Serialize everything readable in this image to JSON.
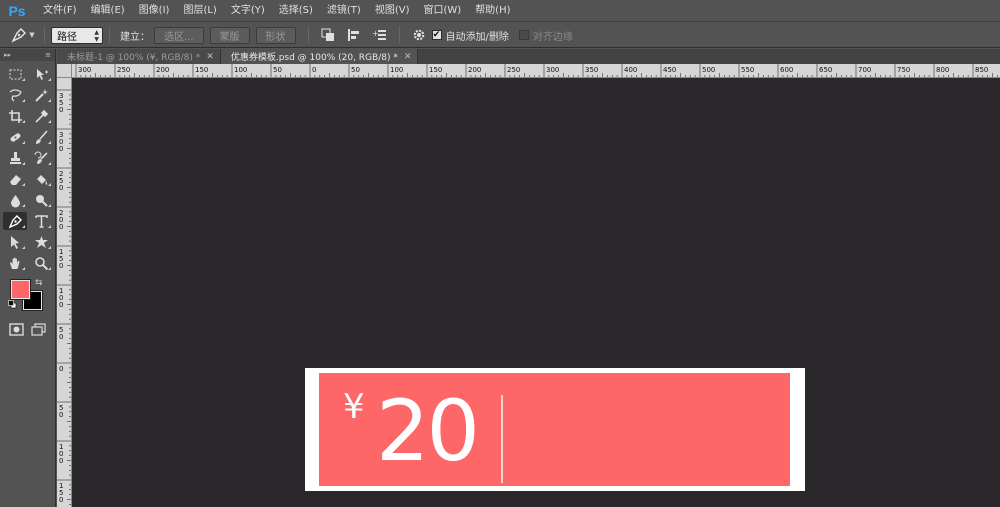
{
  "app": {
    "logo": "Ps"
  },
  "menu": [
    "文件(F)",
    "编辑(E)",
    "图像(I)",
    "图层(L)",
    "文字(Y)",
    "选择(S)",
    "滤镜(T)",
    "视图(V)",
    "窗口(W)",
    "帮助(H)"
  ],
  "options": {
    "mode": "路径",
    "make_label": "建立：",
    "selection_btn": "选区...",
    "mask_btn": "蒙版",
    "shape_btn": "形状",
    "auto_add_delete_label": "自动添加/删除",
    "auto_add_delete_checked": true,
    "align_edges_label": "对齐边缘",
    "align_edges_checked": false
  },
  "tabs": [
    {
      "label": "未标题-1 @ 100% (¥, RGB/8) *",
      "active": false
    },
    {
      "label": "优惠券模板.psd @ 100% (20, RGB/8) *",
      "active": true
    }
  ],
  "ruler": {
    "h_labels": [
      "300",
      "250",
      "200",
      "150",
      "100",
      "50",
      "0",
      "50",
      "100",
      "150",
      "200",
      "250",
      "300",
      "350",
      "400",
      "450",
      "500",
      "550",
      "600",
      "650",
      "700",
      "750",
      "800",
      "850"
    ],
    "v_labels": [
      "3 5 0",
      "3 0 0",
      "2 5 0",
      "2 0 0",
      "1 5 0",
      "1 0 0",
      "5 0",
      "0",
      "5 0",
      "1 0 0",
      "1 5 0"
    ]
  },
  "colors": {
    "foreground": "#fe6768",
    "background": "#000000",
    "coupon": "#fe6768"
  },
  "coupon": {
    "currency": "¥",
    "amount": "20"
  }
}
